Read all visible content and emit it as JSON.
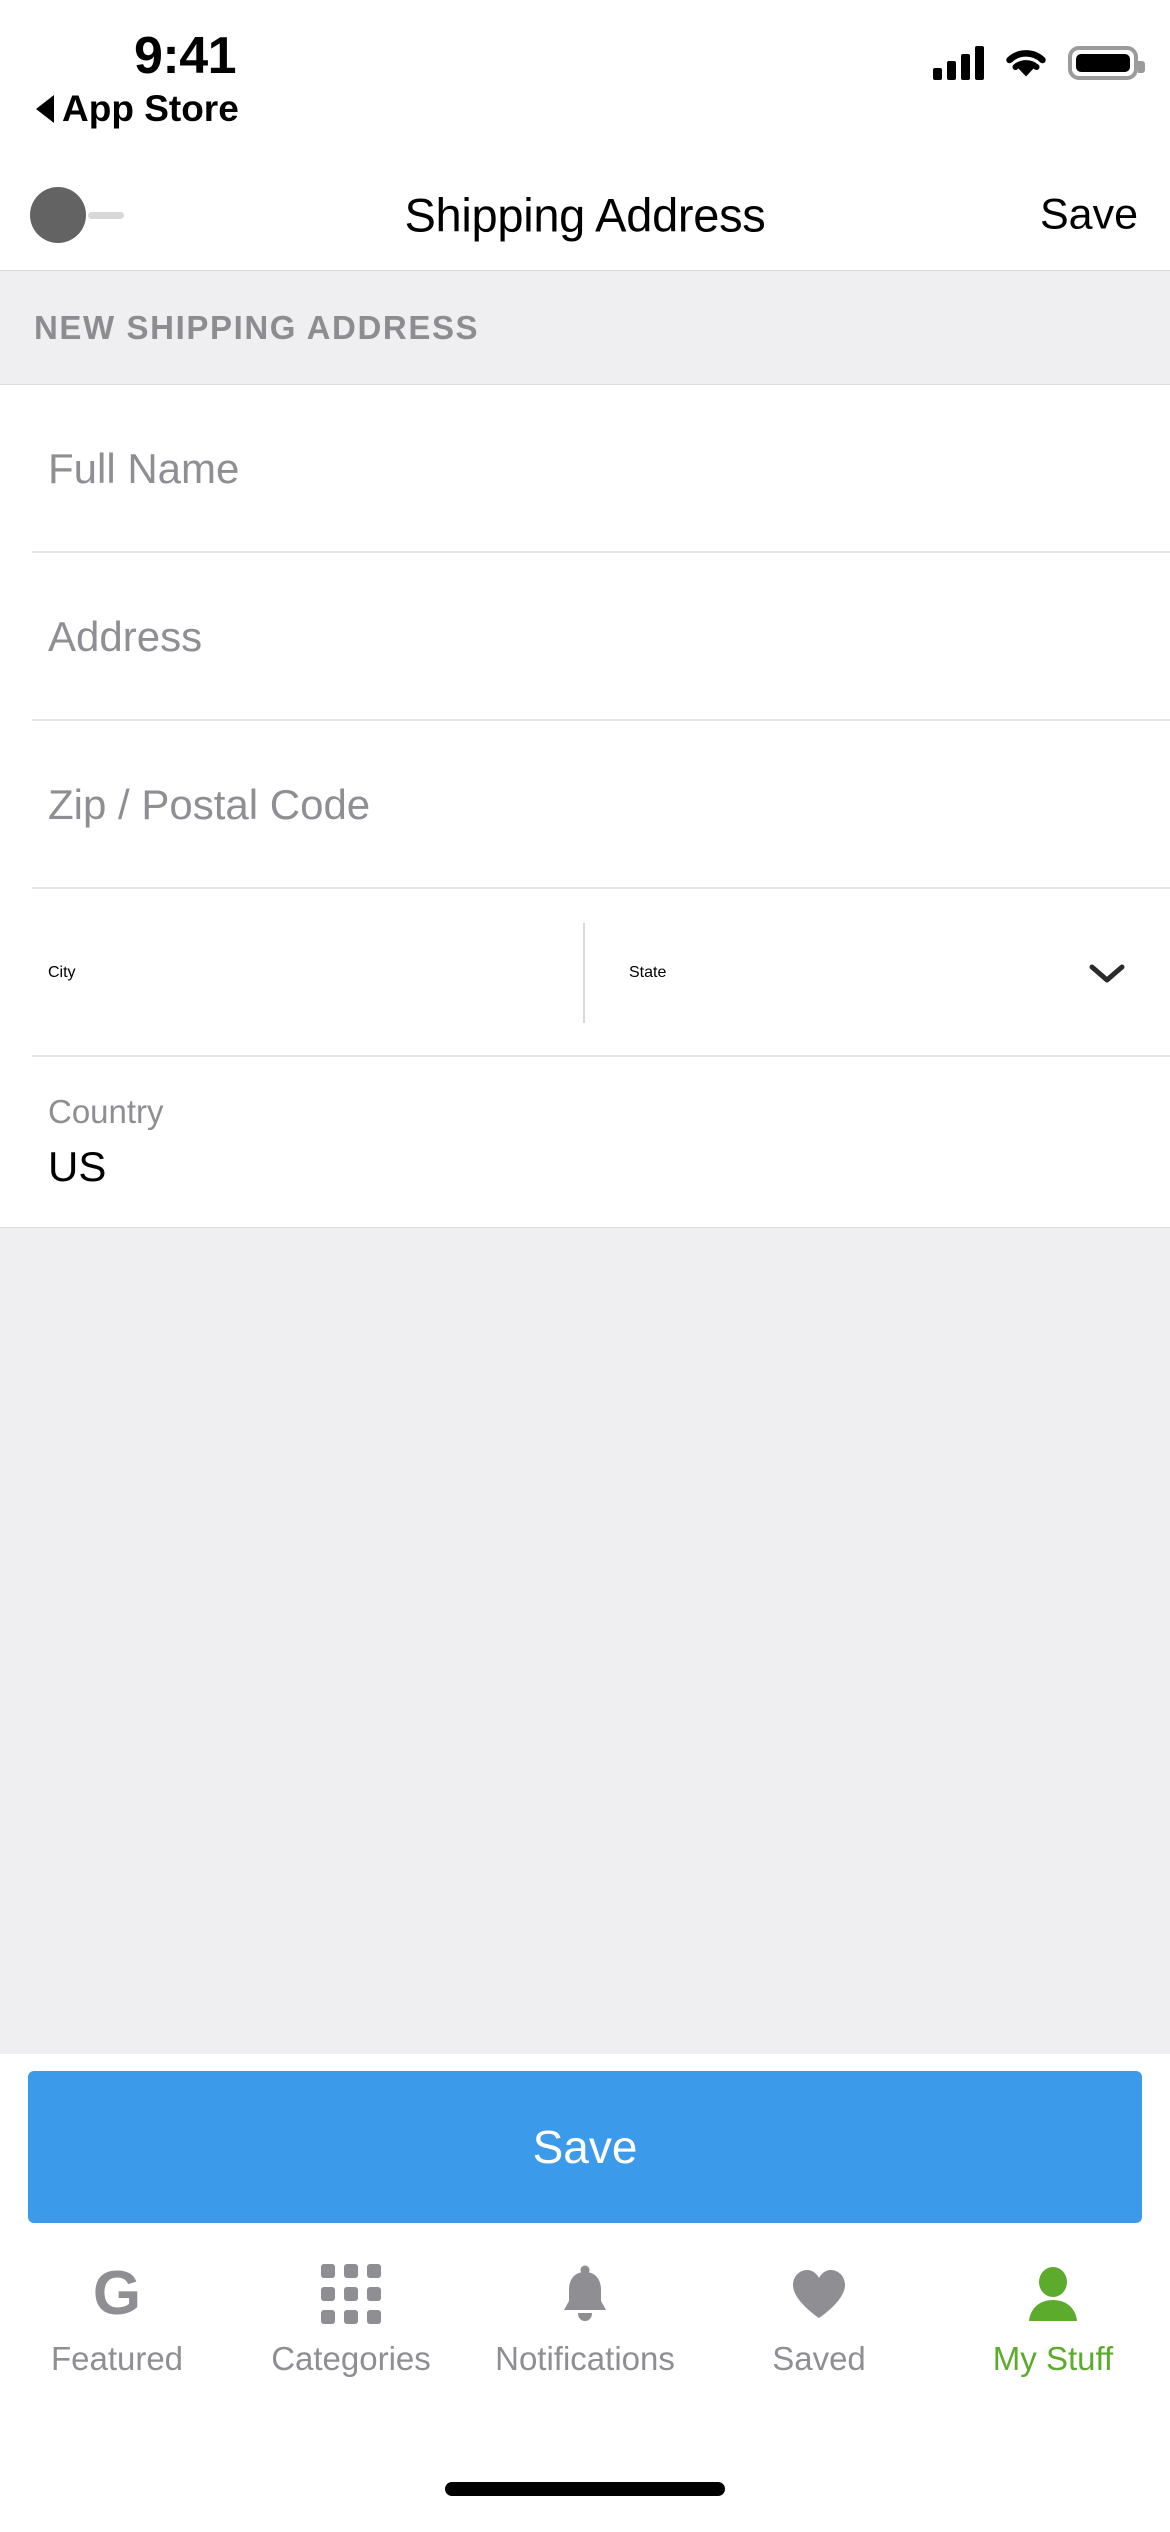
{
  "status_bar": {
    "time": "9:41",
    "back_label": "App Store",
    "signal_icon": "cellular-signal-icon",
    "wifi_icon": "wifi-icon",
    "battery_icon": "battery-full-icon"
  },
  "nav_bar": {
    "title": "Shipping Address",
    "save_label": "Save",
    "left_placeholder_icon": "avatar-placeholder-icon"
  },
  "section": {
    "header": "NEW SHIPPING ADDRESS"
  },
  "form": {
    "full_name": {
      "placeholder": "Full Name",
      "value": ""
    },
    "address": {
      "placeholder": "Address",
      "value": ""
    },
    "zip": {
      "placeholder": "Zip / Postal Code",
      "value": ""
    },
    "city": {
      "placeholder": "City",
      "value": ""
    },
    "state": {
      "placeholder": "State",
      "value": "",
      "chevron_icon": "chevron-down-icon"
    },
    "country": {
      "label": "Country",
      "value": "US"
    }
  },
  "cta": {
    "save_label": "Save",
    "color": "#3b9ae9"
  },
  "tab_bar": {
    "active_color": "#5cab2c",
    "inactive_color": "#8e8e93",
    "tabs": [
      {
        "label": "Featured",
        "icon": "g-logo-icon",
        "active": false
      },
      {
        "label": "Categories",
        "icon": "grid-icon",
        "active": false
      },
      {
        "label": "Notifications",
        "icon": "bell-icon",
        "active": false
      },
      {
        "label": "Saved",
        "icon": "heart-icon",
        "active": false
      },
      {
        "label": "My Stuff",
        "icon": "person-icon",
        "active": true
      }
    ]
  },
  "home_indicator": {
    "icon": "home-indicator-bar"
  }
}
